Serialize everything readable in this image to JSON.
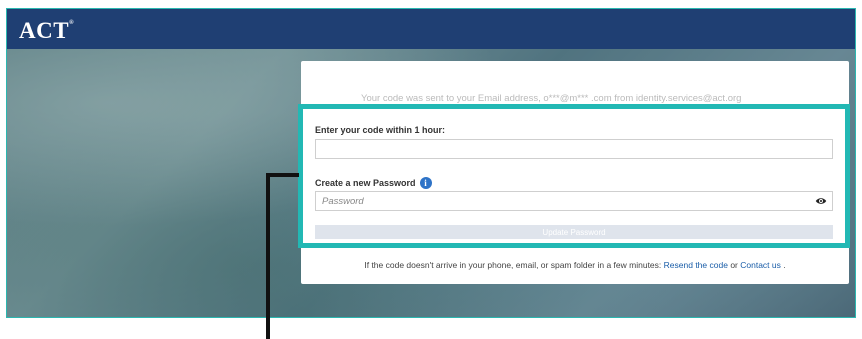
{
  "header": {
    "logo_text": "ACT",
    "logo_mark": "®"
  },
  "form": {
    "sent_notice": "Your code was sent to your Email address, o***@m*** .com from identity.services@act.org",
    "code_label": "Enter your code within 1 hour:",
    "code_value": "",
    "password_label": "Create a new Password",
    "password_placeholder": "Password",
    "info_icon_glyph": "i",
    "submit_label": "Update Password"
  },
  "footer": {
    "prefix": "If the code doesn't arrive in your phone, email, or spam folder in a few minutes:",
    "resend_link": "Resend the code",
    "or_text": "or",
    "contact_link": "Contact us",
    "suffix": "."
  },
  "colors": {
    "header_bg": "#1f3f73",
    "highlight": "#22b8b4",
    "link": "#1a5da8",
    "info_icon": "#2e73c7"
  },
  "icons": {
    "info": "info-icon",
    "eye": "eye-icon"
  }
}
